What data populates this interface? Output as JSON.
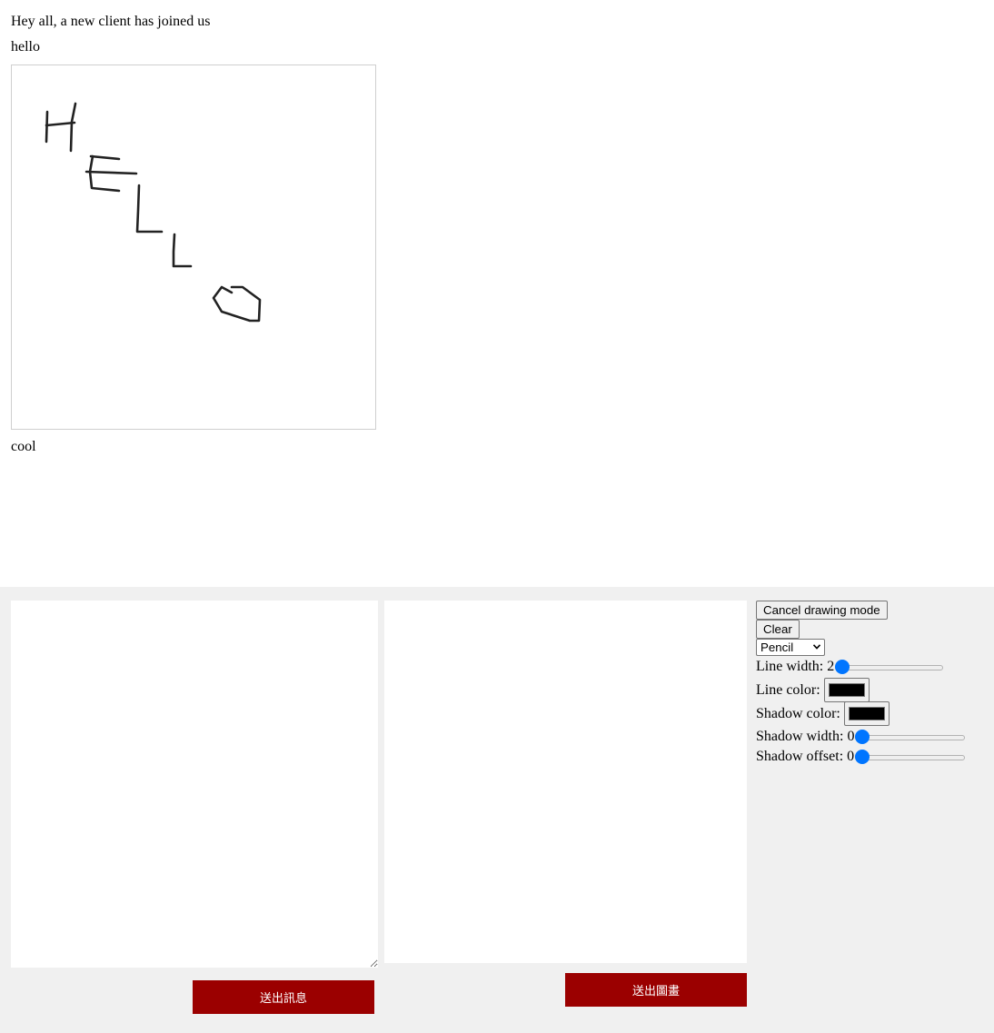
{
  "messages": {
    "join_notice": "Hey all, a new client has joined us",
    "first": "hello",
    "last": "cool"
  },
  "composer": {
    "message_value": "",
    "send_message_label": "送出訊息",
    "send_drawing_label": "送出圖畫"
  },
  "toolbar": {
    "cancel_drawing_label": "Cancel drawing mode",
    "clear_label": "Clear",
    "tool_selected": "Pencil",
    "line_width_label": "Line width:",
    "line_width_value": "2",
    "line_color_label": "Line color:",
    "shadow_color_label": "Shadow color:",
    "shadow_width_label": "Shadow width:",
    "shadow_width_value": "0",
    "shadow_offset_label": "Shadow offset:",
    "shadow_offset_value": "0"
  },
  "colors": {
    "line_color": "#000000",
    "shadow_color": "#000000",
    "button_red": "#9b0000",
    "slider_accent": "#0075ff",
    "panel_bg": "#f0f0f0"
  },
  "sliders": {
    "line_width_fraction": 0.0,
    "shadow_width_fraction": 0.0,
    "shadow_offset_fraction": 0.0
  }
}
